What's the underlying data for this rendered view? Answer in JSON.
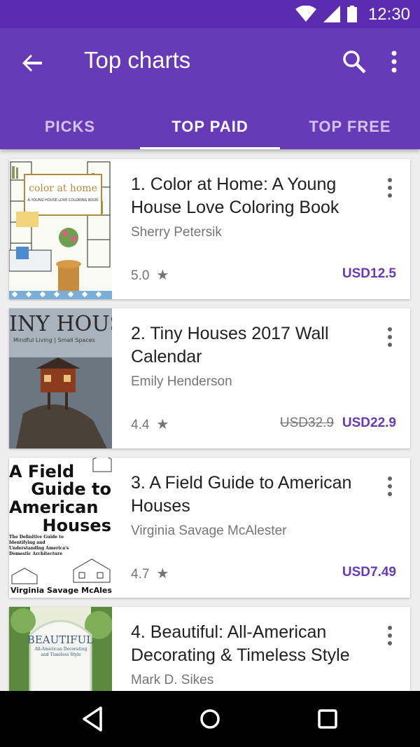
{
  "status_bar": {
    "time": "12:30"
  },
  "app_bar": {
    "title": "Top charts"
  },
  "tabs": [
    {
      "label": "PICKS",
      "active": false
    },
    {
      "label": "TOP PAID",
      "active": true
    },
    {
      "label": "TOP FREE",
      "active": false
    }
  ],
  "books": [
    {
      "title": "1. Color at Home: A Young House Love Coloring Book",
      "author": "Sherry Petersik",
      "rating": "5.0",
      "price": "USD12.5",
      "original_price": "",
      "cover": {
        "text": "color at home",
        "subtitle": "A YOUNG HOUSE LOVE COLORING BOOK"
      }
    },
    {
      "title": "2. Tiny Houses 2017 Wall Calendar",
      "author": "Emily Henderson",
      "rating": "4.4",
      "price": "USD22.9",
      "original_price": "USD32.9",
      "cover": {
        "text": "INY HOUSE",
        "subtitle": "Mindful Living | Small Spaces"
      }
    },
    {
      "title": "3. A Field Guide to American Houses",
      "author": "Virginia Savage McAlester",
      "rating": "4.7",
      "price": "USD7.49",
      "original_price": "",
      "cover": {
        "line1": "A Field",
        "line2": "Guide to",
        "line3": "American",
        "line4": "Houses",
        "subtitle": "The Definitive Guide to Identifying and Understanding America's Domestic Architecture",
        "author": "Virginia Savage McAlester"
      }
    },
    {
      "title": "4. Beautiful: All-American Decorating & Timeless Style",
      "author": "Mark D. Sikes",
      "rating": "",
      "price": "",
      "original_price": "",
      "cover": {
        "text": "BEAUTIFUL",
        "subtitle": "All-American Decorating and Timeless Style"
      }
    }
  ],
  "colors": {
    "primary": "#673ab7",
    "status_bar": "#5b2bb0",
    "price": "#673ab7"
  },
  "icons": [
    "wifi-icon",
    "signal-icon",
    "battery-icon",
    "back-arrow-icon",
    "search-icon",
    "more-vert-icon",
    "star-icon",
    "nav-back-icon",
    "nav-home-icon",
    "nav-recents-icon"
  ]
}
